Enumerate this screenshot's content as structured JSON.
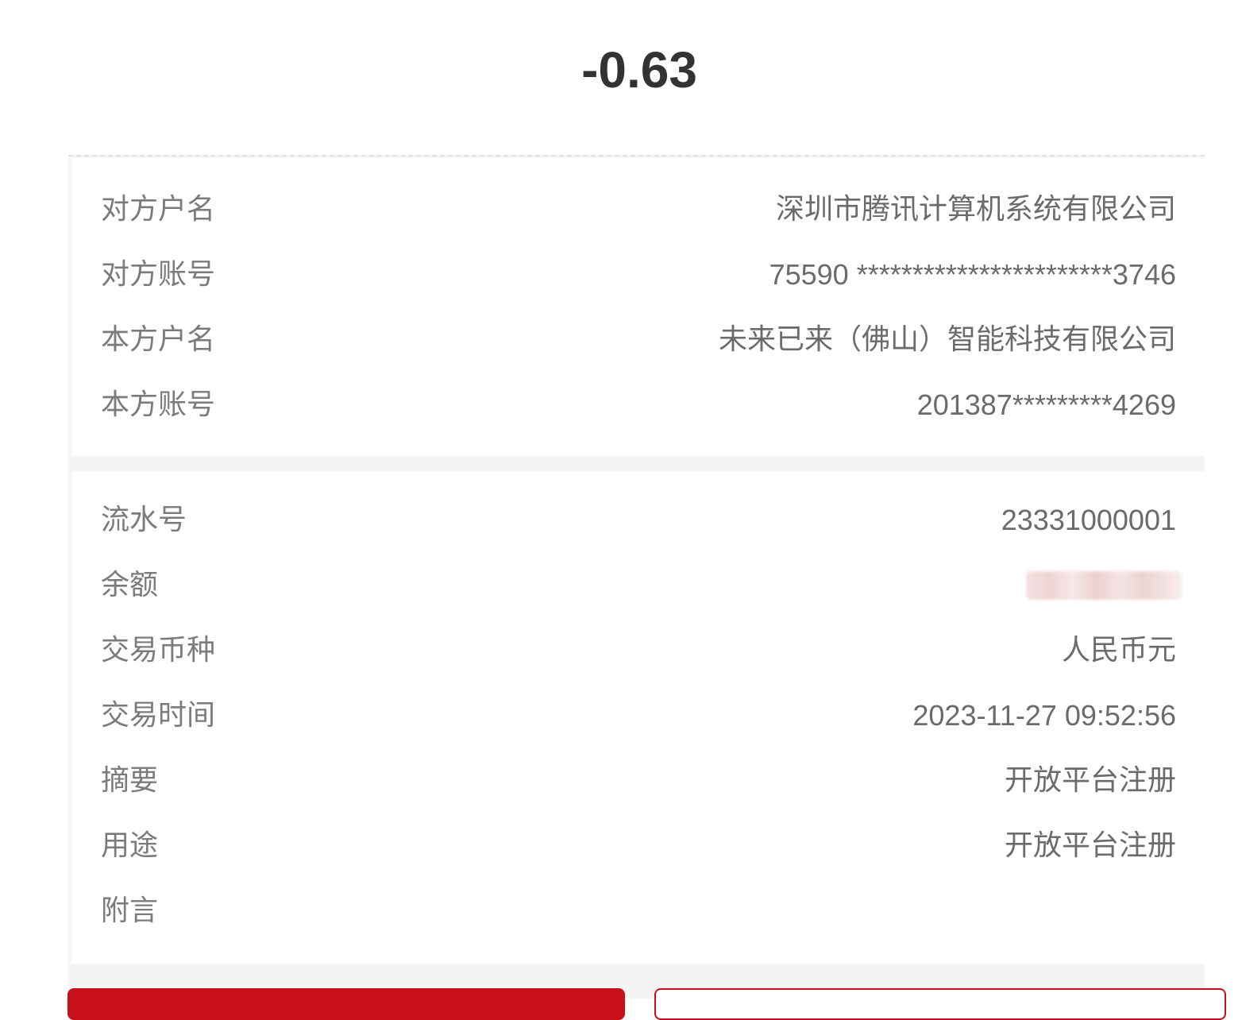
{
  "amount": "-0.63",
  "counterparty": {
    "name_label": "对方户名",
    "name_value": "深圳市腾讯计算机系统有限公司",
    "account_label": "对方账号",
    "account_value": "75590 ***********************3746"
  },
  "own": {
    "name_label": "本方户名",
    "name_value": "未来已来（佛山）智能科技有限公司",
    "account_label": "本方账号",
    "account_value": "201387*********4269"
  },
  "details": {
    "serial_label": "流水号",
    "serial_value": "23331000001",
    "balance_label": "余额",
    "currency_label": "交易币种",
    "currency_value": "人民币元",
    "time_label": "交易时间",
    "time_value": "2023-11-27 09:52:56",
    "summary_label": "摘要",
    "summary_value": "开放平台注册",
    "purpose_label": "用途",
    "purpose_value": "开放平台注册",
    "remark_label": "附言",
    "remark_value": ""
  },
  "colors": {
    "accent": "#c8101a",
    "label_text": "#7b7b7b",
    "value_text": "#6b6b6b",
    "background": "#f4f4f4"
  }
}
